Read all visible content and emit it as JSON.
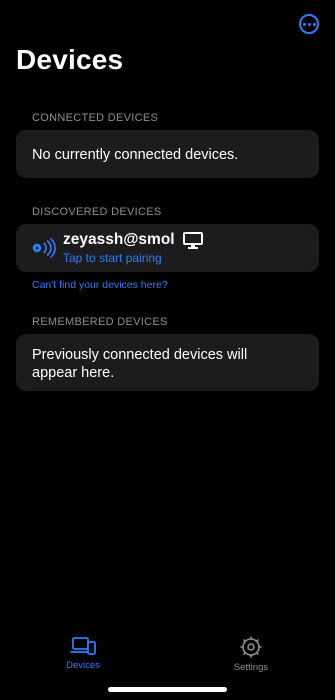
{
  "header": {
    "title": "Devices",
    "more_icon": "ellipsis-circle-icon",
    "accent": "#2f7cf6"
  },
  "connected": {
    "header": "CONNECTED DEVICES",
    "empty_text": "No currently connected devices."
  },
  "discovered": {
    "header": "DISCOVERED DEVICES",
    "device": {
      "name": "zeyassh@smol",
      "subtitle": "Tap to start pairing",
      "status_icon": "broadcast-signal-icon",
      "type_icon": "desktop-monitor-icon"
    },
    "help_link": "Can't find your devices here?"
  },
  "remembered": {
    "header": "REMEMBERED DEVICES",
    "empty_text": "Previously connected devices will appear here."
  },
  "tabbar": {
    "tabs": [
      {
        "label": "Devices",
        "icon": "devices-icon",
        "active": true
      },
      {
        "label": "Settings",
        "icon": "gear-icon",
        "active": false
      }
    ],
    "active_color": "#2f7cf6",
    "inactive_color": "#8e8e93"
  }
}
